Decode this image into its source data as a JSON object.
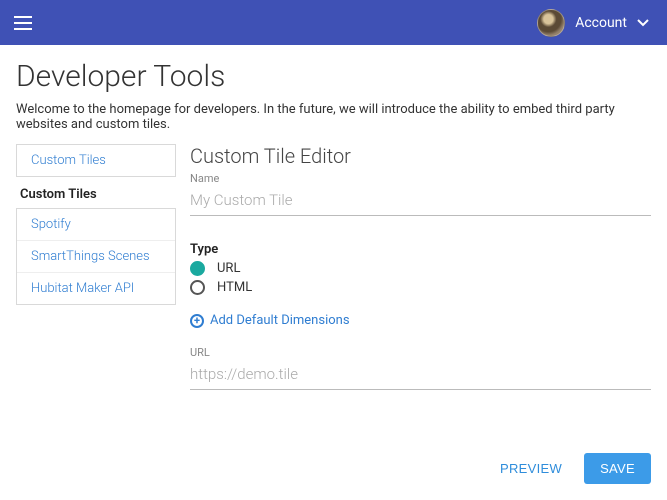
{
  "header": {
    "account_label": "Account"
  },
  "page": {
    "title": "Developer Tools",
    "intro": "Welcome to the homepage for developers. In the future, we will introduce the ability to embed third party websites and custom tiles."
  },
  "sidebar": {
    "nav_item": "Custom Tiles",
    "section_label": "Custom Tiles",
    "items": [
      {
        "label": "Spotify"
      },
      {
        "label": "SmartThings Scenes"
      },
      {
        "label": "Hubitat Maker API"
      }
    ]
  },
  "editor": {
    "title": "Custom Tile Editor",
    "name_label": "Name",
    "name_placeholder": "My Custom Tile",
    "type_label": "Type",
    "type_options": {
      "url": "URL",
      "html": "HTML"
    },
    "type_selected": "url",
    "add_dimensions": "Add Default Dimensions",
    "url_label": "URL",
    "url_placeholder": "https://demo.tile"
  },
  "footer": {
    "preview": "PREVIEW",
    "save": "SAVE"
  }
}
